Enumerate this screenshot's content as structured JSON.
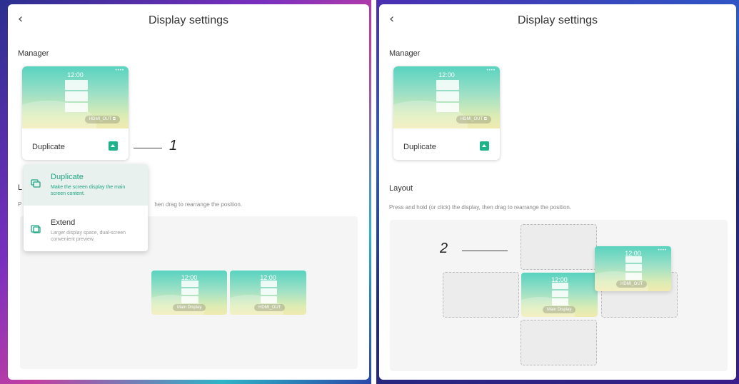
{
  "left": {
    "title": "Display settings",
    "back_glyph": "‹",
    "manager_label": "Manager",
    "layout_label": "L",
    "layout_hint": "hen drag to rearrange the position.",
    "card": {
      "clock": "12:00",
      "output": "HDMI_OUT",
      "mode": "Duplicate"
    },
    "dropdown": [
      {
        "title": "Duplicate",
        "desc": "Make the screen display the main screen content.",
        "icon": "duplicate-icon"
      },
      {
        "title": "Extend",
        "desc": "Larger display space, dual-screen convenient preview.",
        "icon": "extend-icon"
      }
    ],
    "layout_displays": [
      {
        "clock": "12:00",
        "label": "Main Display"
      },
      {
        "clock": "12:00",
        "label": "HDMI_OUT"
      }
    ],
    "callout": "1"
  },
  "right": {
    "title": "Display settings",
    "back_glyph": "‹",
    "manager_label": "Manager",
    "layout_label": "Layout",
    "layout_hint": "Press and hold (or click) the display, then drag to rearrange the position.",
    "card": {
      "clock": "12:00",
      "output": "HDMI_OUT",
      "mode": "Duplicate"
    },
    "layout_displays": [
      {
        "clock": "12:00",
        "label": "Main Display"
      },
      {
        "clock": "12:00",
        "label": "HDMI_OUT"
      }
    ],
    "callout": "2"
  },
  "colors": {
    "accent": "#1fb38a",
    "canvas_bg": "#f5f5f5"
  }
}
